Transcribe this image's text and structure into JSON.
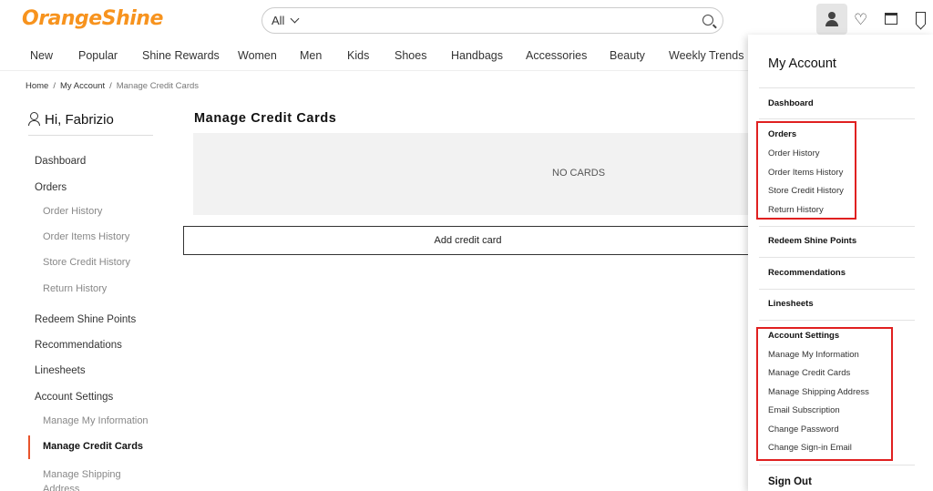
{
  "header": {
    "logo": "OrangeShine",
    "search_scope": "All",
    "search_placeholder": ""
  },
  "nav": [
    "New",
    "Popular",
    "Shine Rewards",
    "Women",
    "Men",
    "Kids",
    "Shoes",
    "Handbags",
    "Accessories",
    "Beauty",
    "Weekly Trends"
  ],
  "breadcrumb": [
    "Home",
    "My Account",
    "Manage Credit Cards"
  ],
  "sidebar": {
    "greeting": "Hi, Fabrizio",
    "items": [
      {
        "label": "Dashboard"
      },
      {
        "label": "Orders"
      },
      {
        "label": "Order History"
      },
      {
        "label": "Order Items History"
      },
      {
        "label": "Store Credit History"
      },
      {
        "label": "Return History"
      },
      {
        "label": "Redeem Shine Points"
      },
      {
        "label": "Recommendations"
      },
      {
        "label": "Linesheets"
      },
      {
        "label": "Account Settings"
      },
      {
        "label": "Manage My Information"
      },
      {
        "label": "Manage Credit Cards"
      },
      {
        "label": "Manage Shipping Address"
      }
    ]
  },
  "main": {
    "title": "Manage Credit Cards",
    "empty_text": "NO CARDS",
    "add_button": "Add credit card"
  },
  "dropdown": {
    "title": "My Account",
    "dashboard": "Dashboard",
    "orders": "Orders",
    "order_history": "Order History",
    "order_items_history": "Order Items History",
    "store_credit_history": "Store Credit History",
    "return_history": "Return History",
    "redeem": "Redeem Shine Points",
    "recommendations": "Recommendations",
    "linesheets": "Linesheets",
    "account_settings": "Account Settings",
    "manage_info": "Manage My Information",
    "manage_cards": "Manage Credit Cards",
    "manage_shipping": "Manage Shipping Address",
    "email_sub": "Email Subscription",
    "change_password": "Change Password",
    "change_signin": "Change Sign-in Email",
    "sign_out": "Sign Out"
  },
  "colors": {
    "brand": "#f7931e",
    "active_marker": "#e8542c",
    "highlight_box": "#e02020"
  }
}
